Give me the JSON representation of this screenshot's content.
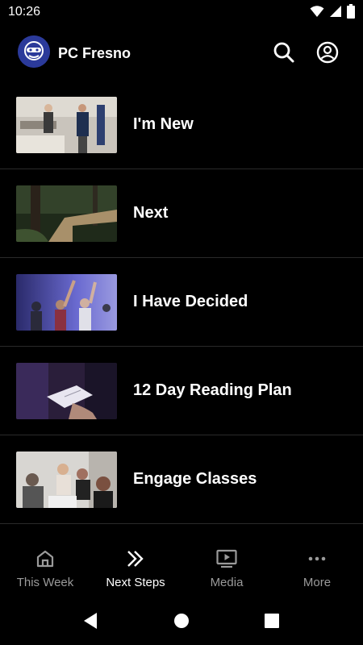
{
  "status_bar": {
    "time": "10:26",
    "icons": [
      "wifi-icon",
      "signal-icon",
      "battery-icon"
    ]
  },
  "app_bar": {
    "title": "PC Fresno",
    "logo": "pc-fresno-logo",
    "actions": [
      "search-icon",
      "account-icon"
    ]
  },
  "list": {
    "items": [
      {
        "label": "I'm New",
        "thumbnail": "people-in-lobby"
      },
      {
        "label": "Next",
        "thumbnail": "forest-boardwalk"
      },
      {
        "label": "I Have Decided",
        "thumbnail": "worship-crowd"
      },
      {
        "label": "12 Day Reading Plan",
        "thumbnail": "open-bible"
      },
      {
        "label": "Engage Classes",
        "thumbnail": "class-audience"
      }
    ]
  },
  "bottom_nav": {
    "items": [
      {
        "label": "This Week",
        "icon": "home-icon",
        "active": false
      },
      {
        "label": "Next Steps",
        "icon": "double-chevron-icon",
        "active": true
      },
      {
        "label": "Media",
        "icon": "play-screen-icon",
        "active": false
      },
      {
        "label": "More",
        "icon": "more-dots-icon",
        "active": false
      }
    ]
  },
  "colors": {
    "background": "#000000",
    "text": "#ffffff",
    "inactive_text": "#9a9a9a",
    "divider": "#2a2a2a",
    "logo_bg": "#2b3a9a"
  }
}
